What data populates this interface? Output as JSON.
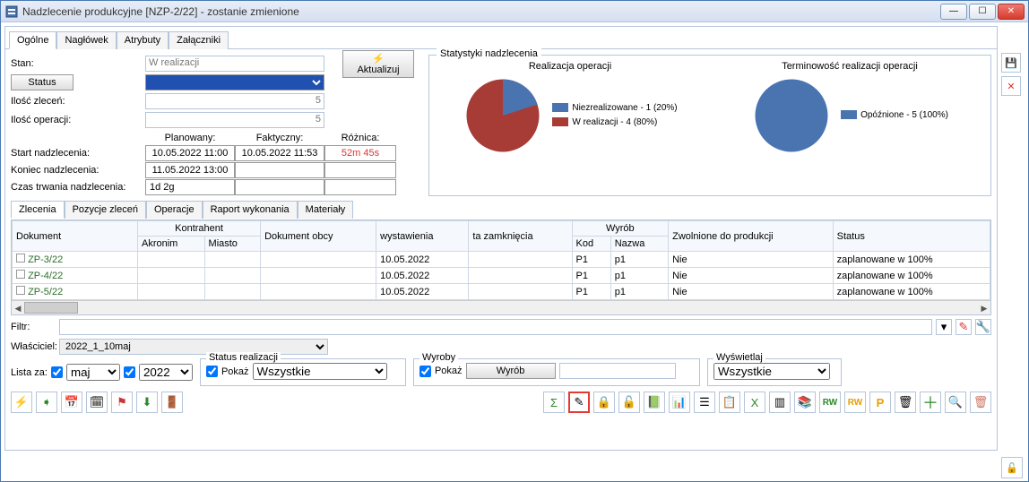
{
  "window": {
    "title": "Nadzlecenie produkcyjne [NZP-2/22] - zostanie zmienione"
  },
  "toptabs": [
    "Ogólne",
    "Nagłówek",
    "Atrybuty",
    "Załączniki"
  ],
  "form": {
    "stan_label": "Stan:",
    "stan_value": "W realizacji",
    "status_btn": "Status",
    "update_btn": "Aktualizuj",
    "ilosc_zlecen_label": "Ilość zleceń:",
    "ilosc_zlecen_value": "5",
    "ilosc_operacji_label": "Ilość operacji:",
    "ilosc_operacji_value": "5",
    "plan_header": "Planowany:",
    "fact_header": "Faktyczny:",
    "diff_header": "Różnica:",
    "start_label": "Start nadzlecenia:",
    "start_plan": "10.05.2022 11:00",
    "start_fact": "10.05.2022 11:53",
    "start_diff": "52m 45s",
    "end_label": "Koniec nadzlecenia:",
    "end_plan": "11.05.2022 13:00",
    "end_fact": "",
    "end_diff": "",
    "duration_label": "Czas trwania nadzlecenia:",
    "duration_plan": "1d 2g",
    "duration_fact": "",
    "duration_diff": ""
  },
  "stats": {
    "legend": "Statystyki nadzlecenia",
    "chart1_title": "Realizacja operacji",
    "chart2_title": "Terminowość realizacji operacji",
    "c1_item1": "Niezrealizowane - 1 (20%)",
    "c1_item2": "W realizacji - 4 (80%)",
    "c2_item1": "Opóźnione - 5 (100%)"
  },
  "chart_data": [
    {
      "type": "pie",
      "title": "Realizacja operacji",
      "series": [
        {
          "name": "Niezrealizowane",
          "value": 1,
          "pct": 20,
          "color": "#4a74b0"
        },
        {
          "name": "W realizacji",
          "value": 4,
          "pct": 80,
          "color": "#a73b36"
        }
      ]
    },
    {
      "type": "pie",
      "title": "Terminowość realizacji operacji",
      "series": [
        {
          "name": "Opóźnione",
          "value": 5,
          "pct": 100,
          "color": "#4a74b0"
        }
      ]
    }
  ],
  "subtabs": [
    "Zlecenia",
    "Pozycje zleceń",
    "Operacje",
    "Raport wykonania",
    "Materiały"
  ],
  "grid": {
    "h_dokument": "Dokument",
    "h_kontrahent": "Kontrahent",
    "h_akronim": "Akronim",
    "h_miasto": "Miasto",
    "h_obcy": "Dokument obcy",
    "h_wyst": "wystawienia",
    "h_zamk": "ta zamknięcia",
    "h_wyrob": "Wyrób",
    "h_kod": "Kod",
    "h_nazwa": "Nazwa",
    "h_zwol": "Zwolnione do produkcji",
    "h_status": "Status",
    "rows": [
      {
        "doc": "ZP-3/22",
        "wyst": "10.05.2022",
        "kod": "P1",
        "nazwa": "p1",
        "zwol": "Nie",
        "status": "zaplanowane w 100%"
      },
      {
        "doc": "ZP-4/22",
        "wyst": "10.05.2022",
        "kod": "P1",
        "nazwa": "p1",
        "zwol": "Nie",
        "status": "zaplanowane w 100%"
      },
      {
        "doc": "ZP-5/22",
        "wyst": "10.05.2022",
        "kod": "P1",
        "nazwa": "p1",
        "zwol": "Nie",
        "status": "zaplanowane w 100%"
      }
    ]
  },
  "filter": {
    "filter_label": "Filtr:",
    "owner_label": "Właściciel:",
    "owner_value": "2022_1_10maj"
  },
  "lower": {
    "lista_za_label": "Lista za:",
    "month": "maj",
    "year": "2022",
    "statusreal_legend": "Status realizacji",
    "pokaz_label": "Pokaż",
    "wszystkie": "Wszystkie",
    "wyroby_legend": "Wyroby",
    "wyrob_btn": "Wyrób",
    "wyswietlaj_legend": "Wyświetlaj"
  }
}
